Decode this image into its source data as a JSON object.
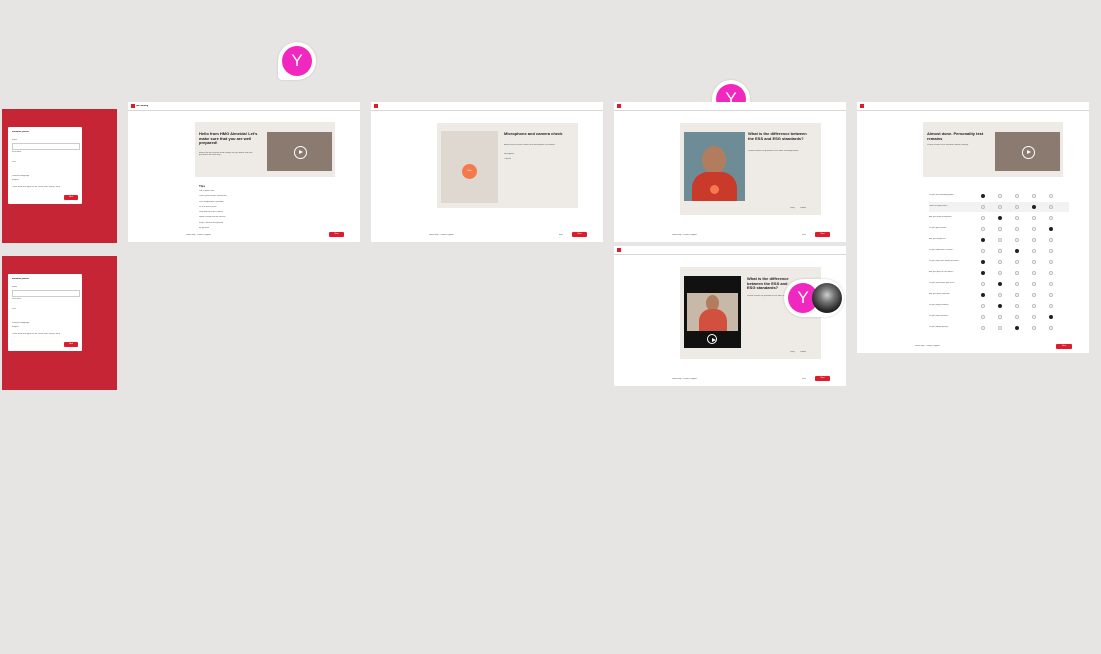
{
  "brand_color": "#e01b2c",
  "canvas_bg": "#e6e5e3",
  "collaborator_initial": "Y",
  "login_frames": [
    {
      "title": "Introduce yourself",
      "email_label": "Email",
      "first_label": "First name",
      "last_label": "Last",
      "lang_label": "Preferred language",
      "lang_value": "English",
      "consent": "I have read and agree to the Terms and Privacy Policy",
      "button": "Next"
    },
    {
      "title": "Introduce yourself",
      "email_label": "Email",
      "first_label": "First name",
      "last_label": "Last",
      "lang_label": "Preferred language",
      "lang_value": "English",
      "consent": "I have read and agree to the Terms and Privacy Policy",
      "button": "Next"
    }
  ],
  "welcome": {
    "brand": "HM Learning",
    "hero_title": "Hello from HMG Almeida! Let's make sure that you are well prepared!",
    "hero_body": "Before we start, please read through the tips below and then proceed to the next step.",
    "tips_heading": "Tips",
    "tips": [
      "Use a quiet room",
      "Check your internet connection",
      "Use headphones if possible",
      "Sit in a well lit place",
      "Look directly at the camera",
      "Speak clearly and not too fast",
      "Keep a neutral background",
      "Be yourself"
    ],
    "footer_link": "Need help? Contact support",
    "button": "Next"
  },
  "mic_check": {
    "hero_title": "Microphone and camera check",
    "hero_body": "Allow access to your camera and microphone to continue.",
    "record_label": "Start",
    "item_1": "Microphone",
    "item_2": "Camera",
    "footer_link": "Need help? Contact support",
    "button": "Next",
    "back": "Back"
  },
  "question": {
    "hero_title": "What is the difference between the ESS and ESG standards?",
    "hero_body": "Please answer the question in the video recording below.",
    "footer_link": "Need help? Contact support",
    "button": "Next",
    "back": "Back",
    "retry": "Retry",
    "submit": "Submit"
  },
  "personality": {
    "hero_title": "Almost done. Personality test remains",
    "hero_body": "Please answer each statement below honestly.",
    "statements": [
      "Do you like meeting people?",
      "Which do you prefer?",
      "Are you easily energized?",
      "Do you plan ahead?",
      "Are you analytical?",
      "Do you work well in teams?",
      "Do you stay calm under pressure?",
      "Are you open to new ideas?",
      "Do you finish what you start?",
      "Are you detail oriented?",
      "Do you enjoy leading?",
      "Do you take initiative?",
      "Do you adapt quickly?"
    ],
    "footer_link": "Need help? Contact support",
    "button": "Next"
  }
}
